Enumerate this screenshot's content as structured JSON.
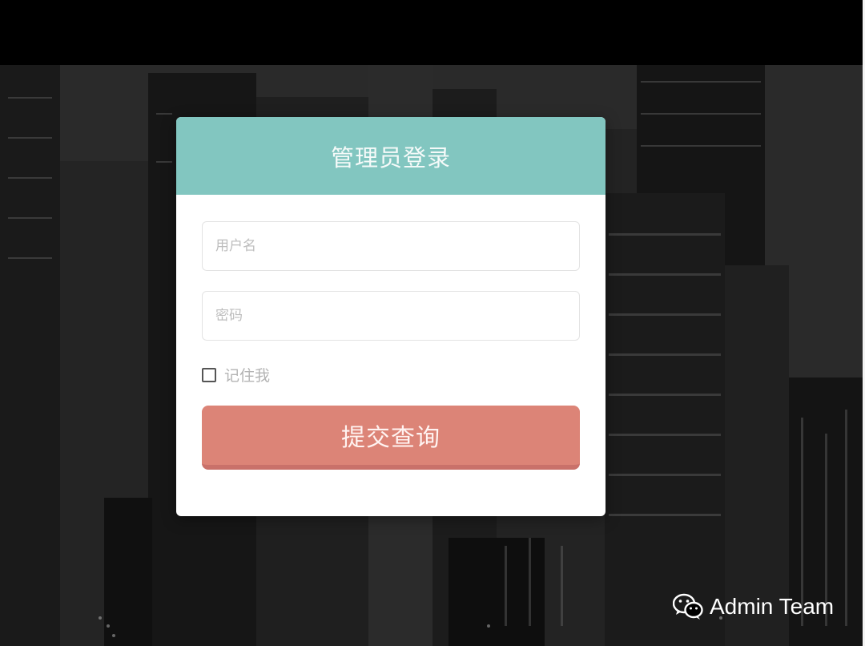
{
  "login": {
    "title": "管理员登录",
    "username_placeholder": "用户名",
    "password_placeholder": "密码",
    "remember_label": "记住我",
    "remember_checked": false,
    "submit_label": "提交查询"
  },
  "watermark": {
    "icon": "wechat-icon",
    "text": "Admin Team"
  },
  "colors": {
    "header": "#82c6c0",
    "submit": "#dc8477",
    "background": "#000000"
  }
}
